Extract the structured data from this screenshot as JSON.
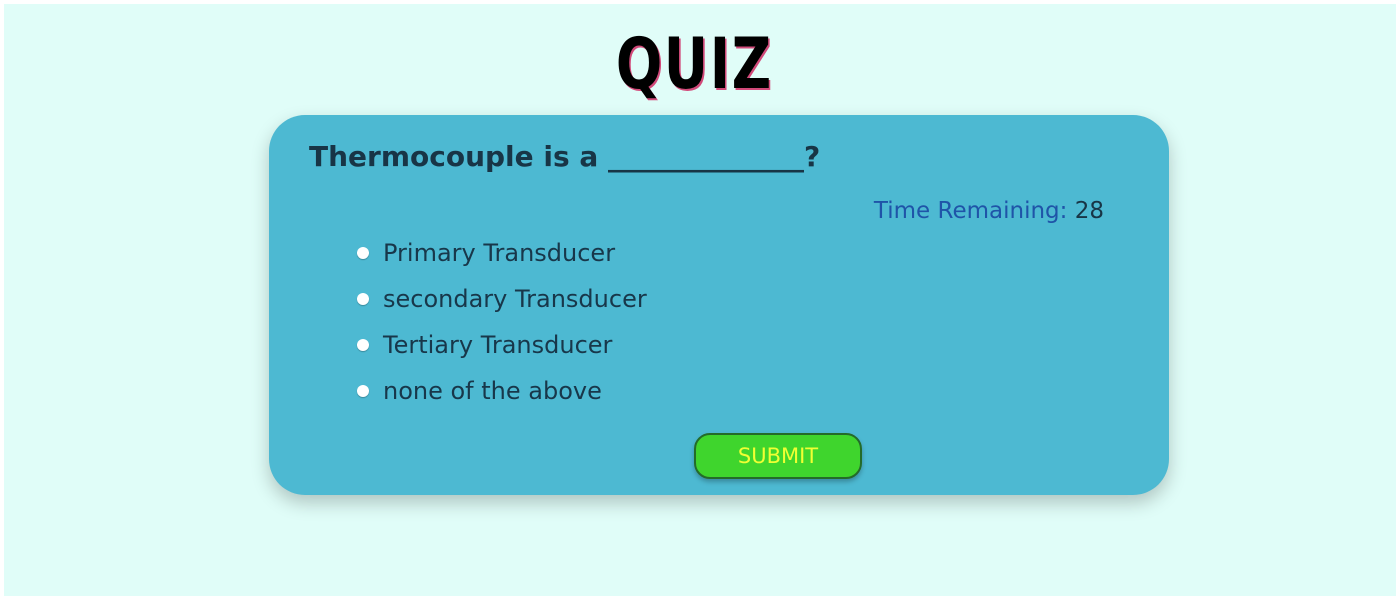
{
  "title": "QUIZ",
  "question": "Thermocouple is a ______________?",
  "timer": {
    "label": "Time Remaining:",
    "value": "28"
  },
  "options": [
    {
      "label": "Primary Transducer",
      "selected": false
    },
    {
      "label": "secondary Transducer",
      "selected": false
    },
    {
      "label": "Tertiary Transducer",
      "selected": false
    },
    {
      "label": "none of the above",
      "selected": false
    }
  ],
  "submit_label": "SUBMIT",
  "colors": {
    "page_background": "#e0fdf8",
    "card_background": "#4db9d2",
    "submit_background": "#3fd52d",
    "submit_text": "#f0ff33",
    "timer_label": "#1f54a8"
  }
}
